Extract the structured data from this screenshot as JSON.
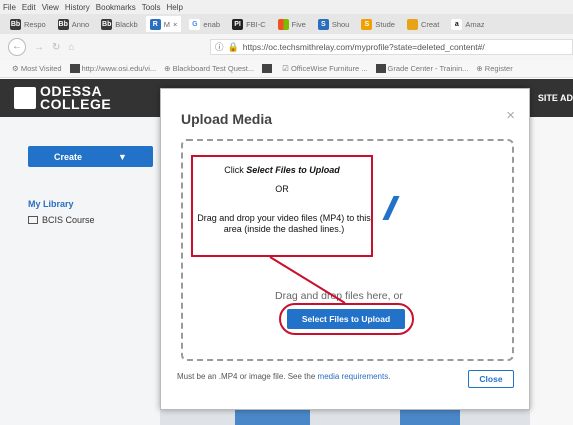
{
  "browser": {
    "menu": [
      "File",
      "Edit",
      "View",
      "History",
      "Bookmarks",
      "Tools",
      "Help"
    ],
    "tabs": [
      {
        "icon": "blackboard-icon",
        "label": "Respo",
        "color": "#3a3a3a",
        "glyph": "Bb"
      },
      {
        "icon": "blackboard-icon",
        "label": "Anno",
        "color": "#3a3a3a",
        "glyph": "Bb"
      },
      {
        "icon": "blackboard-icon",
        "label": "Blackb",
        "color": "#3a3a3a",
        "glyph": "Bb"
      },
      {
        "icon": "relay-icon",
        "label": "M",
        "color": "#2a6ebf",
        "glyph": "R"
      },
      {
        "icon": "google-icon",
        "label": "enab",
        "color": "#ffffff",
        "glyph": "G"
      },
      {
        "icon": "pi-icon",
        "label": "FBI-C",
        "color": "#222222",
        "glyph": "PI"
      },
      {
        "icon": "microsoft-icon",
        "label": "Five",
        "color": "#f25022",
        "glyph": ""
      },
      {
        "icon": "share-icon",
        "label": "Shou",
        "color": "#2a6ebf",
        "glyph": "S"
      },
      {
        "icon": "study-icon",
        "label": "Stude",
        "color": "#f0a000",
        "glyph": "S"
      },
      {
        "icon": "creative-icon",
        "label": "Creat",
        "color": "#e8a317",
        "glyph": ""
      },
      {
        "icon": "amazon-icon",
        "label": "Amaz",
        "color": "#ffffff",
        "glyph": "a"
      }
    ],
    "url": "https://oc.techsmithrelay.com/myprofile?state=deleted_content#/",
    "url_domain": "techsmithrelay.com",
    "bookmarks": [
      "Most Visited",
      "http://www.osi.edu/vi...",
      "Blackboard Test Quest...",
      "OfficeWise Furniture ...",
      "Grade Center - Trainin...",
      "Register"
    ]
  },
  "page": {
    "college_name_line1": "ODESSA",
    "college_name_line2": "COLLEGE",
    "site_admin": "SITE AD",
    "create_label": "Create",
    "create_caret": "▼",
    "my_library": "My Library",
    "course_folder": "BCIS Course"
  },
  "modal": {
    "title": "Upload Media",
    "close_glyph": "×",
    "drop_text": "Drag and drop files here, or",
    "select_button": "Select Files to Upload",
    "requirements_prefix": "Must be an .MP4 or image file. See the",
    "requirements_link": "media requirements",
    "requirements_suffix": ".",
    "close_button": "Close"
  },
  "annotation": {
    "line1_prefix": "Click ",
    "line1_emph": "Select Files to Upload",
    "line2": "OR",
    "line3": "Drag and drop your video files (MP4) to this area (inside the dashed lines.)"
  },
  "colors": {
    "accent": "#2372c9",
    "callout_red": "#c8102e",
    "header_dark": "#333333"
  }
}
